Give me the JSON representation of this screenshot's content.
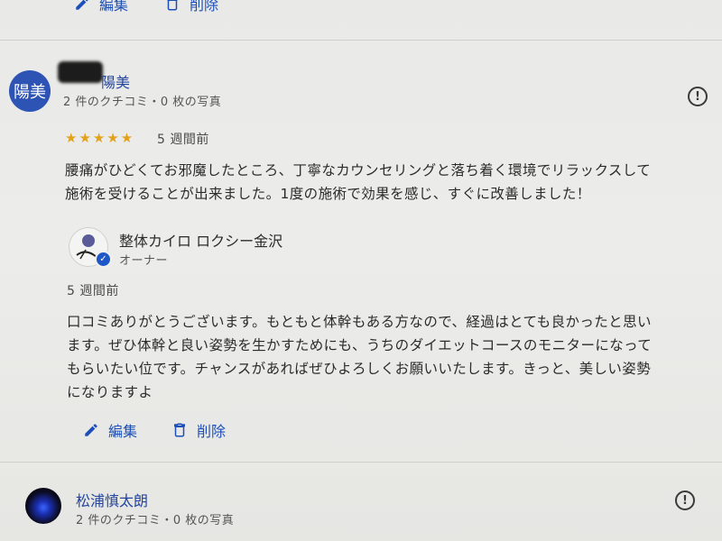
{
  "top_actions": {
    "edit_label": "編集",
    "delete_label": "削除"
  },
  "review1": {
    "avatar_text": "陽美",
    "reviewer_name": "陽美",
    "reviewer_stats": "2 件のクチコミ・0 枚の写真",
    "rating": 5,
    "stars_text": "★★★★★",
    "date": "5 週間前",
    "text_lines": [
      "腰痛がひどくてお邪魔したところ、丁寧なカウンセリングと落ち着く環境でリラックスして",
      "施術を受けることが出来ました。1度の施術で効果を感じ、すぐに改善しました！"
    ],
    "owner_reply": {
      "owner_name": "整体カイロ ロクシー金沢",
      "owner_role": "オーナー",
      "date": "5 週間前",
      "text_lines": [
        "口コミありがとうございます。もともと体幹もある方なので、経過はとても良かったと思い",
        "ます。ぜひ体幹と良い姿勢を生かすためにも、うちのダイエットコースのモニターになって",
        "もらいたい位です。チャンスがあればぜひよろしくお願いいたします。きっと、美しい姿勢",
        "になりますよ"
      ],
      "edit_label": "編集",
      "delete_label": "削除"
    }
  },
  "review2": {
    "reviewer_name": "松浦慎太朗",
    "reviewer_stats": "2 件のクチコミ・0 枚の写真"
  },
  "colors": {
    "link_blue": "#1d4fb8",
    "star": "#e3a21c",
    "avatar_bg": "#2d54b5"
  },
  "icons": [
    "pencil-icon",
    "trash-icon",
    "report-icon",
    "verified-check-icon"
  ]
}
